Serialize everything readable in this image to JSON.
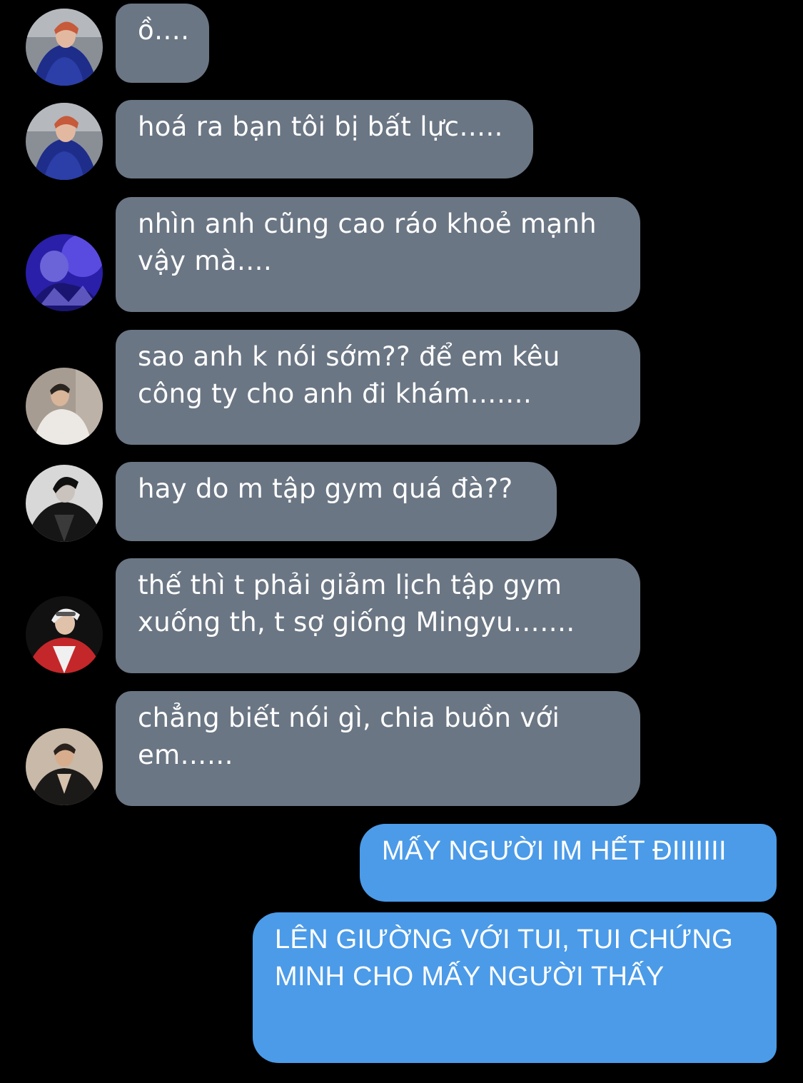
{
  "colors": {
    "background": "#000000",
    "incoming_bubble": "#6b7684",
    "outgoing_bubble": "#4b9be8",
    "text": "#ffffff"
  },
  "messages": [
    {
      "direction": "incoming",
      "avatar": "avatar-blue-sweater",
      "text": "ồ…."
    },
    {
      "direction": "incoming",
      "avatar": "avatar-blue-sweater",
      "text": "hoá ra bạn tôi bị bất lực….."
    },
    {
      "direction": "incoming",
      "avatar": "avatar-purple-light",
      "text": "nhìn anh cũng cao ráo khoẻ mạnh vậy mà…."
    },
    {
      "direction": "incoming",
      "avatar": "avatar-white-shirt",
      "text": "sao anh k nói sớm?? để em kêu công ty cho anh đi khám……."
    },
    {
      "direction": "incoming",
      "avatar": "avatar-black-jacket",
      "text": "hay do m tập gym quá đà??"
    },
    {
      "direction": "incoming",
      "avatar": "avatar-red-jacket",
      "text": "thế thì t phải giảm lịch tập gym xuống th, t sợ giống Mingyu……."
    },
    {
      "direction": "incoming",
      "avatar": "avatar-black-suit",
      "text": "chẳng biết nói gì, chia buồn với em……"
    },
    {
      "direction": "outgoing",
      "text": "MẤY NGƯỜI IM HẾT ĐIIIIIII"
    },
    {
      "direction": "outgoing",
      "text": "LÊN GIƯỜNG VỚI TUI, TUI CHỨNG MINH CHO MẤY NGƯỜI THẤY"
    }
  ]
}
